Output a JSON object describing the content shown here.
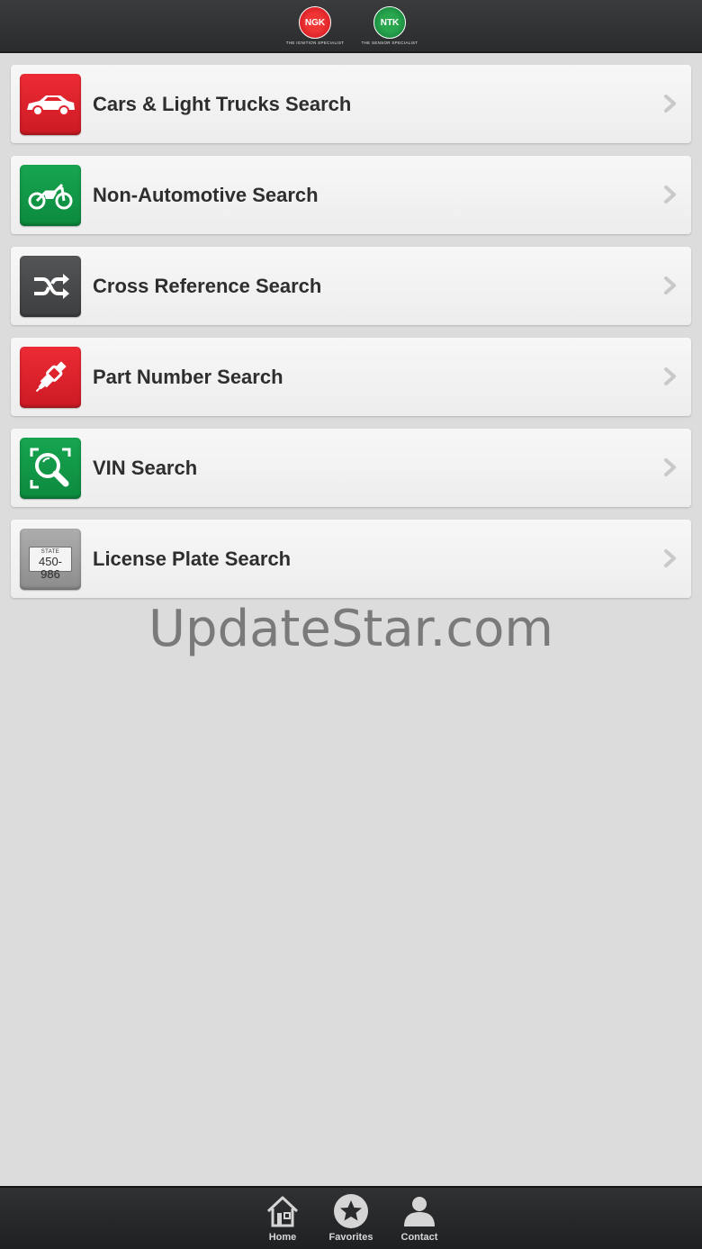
{
  "header": {
    "logos": [
      {
        "mark": "NGK",
        "tagline": "THE IGNITION SPECIALIST",
        "color": "#e0222b"
      },
      {
        "mark": "NTK",
        "tagline": "THE SENSOR SPECIALIST",
        "color": "#1a9444"
      }
    ]
  },
  "menu": {
    "items": [
      {
        "label": "Cars & Light Trucks Search",
        "icon": "car-icon",
        "color": "#e0222b"
      },
      {
        "label": "Non-Automotive Search",
        "icon": "motorcycle-icon",
        "color": "#13994a"
      },
      {
        "label": "Cross Reference Search",
        "icon": "cross-arrows-icon",
        "color": "#4a4b4d"
      },
      {
        "label": "Part Number Search",
        "icon": "spark-plug-icon",
        "color": "#e0222b"
      },
      {
        "label": "VIN Search",
        "icon": "magnifier-icon",
        "color": "#13994a"
      },
      {
        "label": "License Plate Search",
        "icon": "license-plate-icon",
        "color": "#9a9a9a"
      }
    ],
    "plate": {
      "state": "STATE",
      "number": "450-986"
    }
  },
  "watermark": "UpdateStar.com",
  "tabbar": {
    "tabs": [
      {
        "label": "Home",
        "icon": "home-icon"
      },
      {
        "label": "Favorites",
        "icon": "star-icon"
      },
      {
        "label": "Contact",
        "icon": "person-icon"
      }
    ]
  }
}
